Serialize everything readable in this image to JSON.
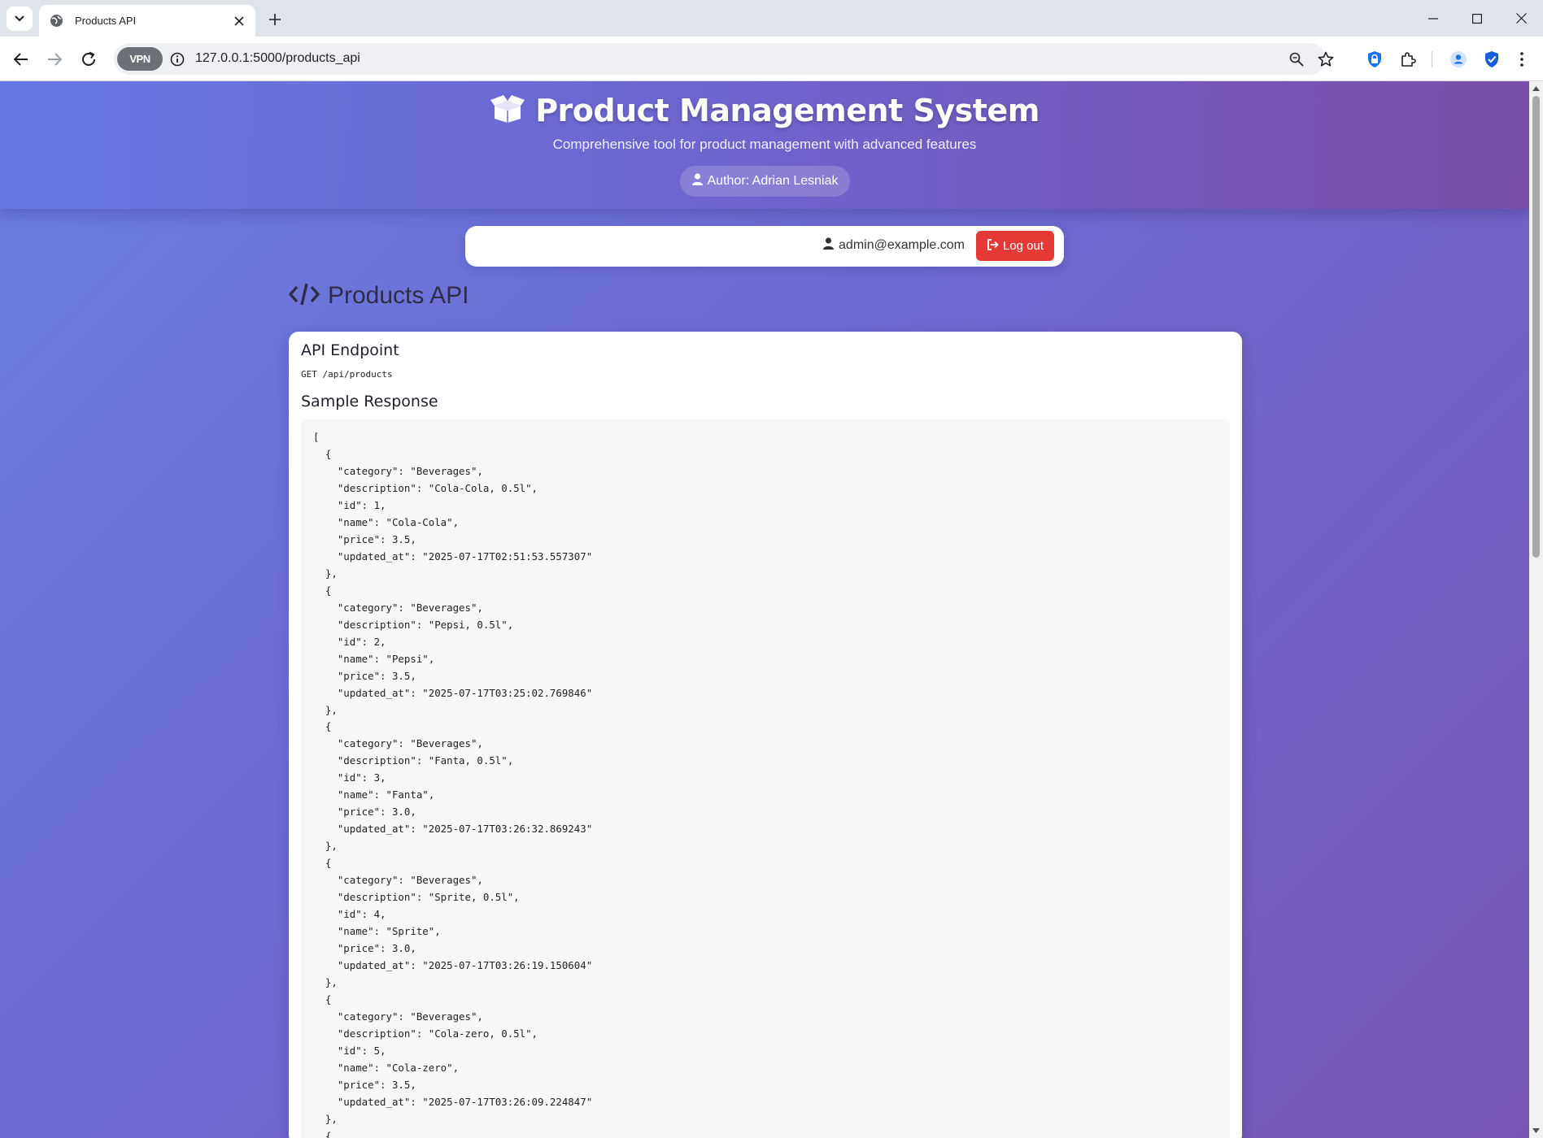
{
  "browser": {
    "tab_title": "Products API",
    "url": "127.0.0.1:5000/products_api",
    "vpn_label": "VPN",
    "icons": [
      "tab-list-icon",
      "globe-icon",
      "close-icon",
      "plus-icon",
      "minimize-icon",
      "maximize-icon",
      "close-window-icon",
      "back-icon",
      "forward-icon",
      "reload-icon",
      "info-icon",
      "zoom-icon",
      "star-icon",
      "shield-icon",
      "extensions-icon",
      "profile-icon",
      "bitwarden-icon",
      "menu-icon"
    ]
  },
  "header": {
    "title": "Product Management System",
    "subtitle": "Comprehensive tool for product management with advanced features",
    "author": "Author: Adrian Lesniak"
  },
  "userbar": {
    "email": "admin@example.com",
    "logout_label": "Log out"
  },
  "page": {
    "heading": "Products API"
  },
  "api": {
    "endpoint_heading": "API Endpoint",
    "endpoint": "GET /api/products",
    "sample_heading": "Sample Response",
    "sample_response": "[\n  {\n    \"category\": \"Beverages\",\n    \"description\": \"Cola-Cola, 0.5l\",\n    \"id\": 1,\n    \"name\": \"Cola-Cola\",\n    \"price\": 3.5,\n    \"updated_at\": \"2025-07-17T02:51:53.557307\"\n  },\n  {\n    \"category\": \"Beverages\",\n    \"description\": \"Pepsi, 0.5l\",\n    \"id\": 2,\n    \"name\": \"Pepsi\",\n    \"price\": 3.5,\n    \"updated_at\": \"2025-07-17T03:25:02.769846\"\n  },\n  {\n    \"category\": \"Beverages\",\n    \"description\": \"Fanta, 0.5l\",\n    \"id\": 3,\n    \"name\": \"Fanta\",\n    \"price\": 3.0,\n    \"updated_at\": \"2025-07-17T03:26:32.869243\"\n  },\n  {\n    \"category\": \"Beverages\",\n    \"description\": \"Sprite, 0.5l\",\n    \"id\": 4,\n    \"name\": \"Sprite\",\n    \"price\": 3.0,\n    \"updated_at\": \"2025-07-17T03:26:19.150604\"\n  },\n  {\n    \"category\": \"Beverages\",\n    \"description\": \"Cola-zero, 0.5l\",\n    \"id\": 5,\n    \"name\": \"Cola-zero\",\n    \"price\": 3.5,\n    \"updated_at\": \"2025-07-17T03:26:09.224847\"\n  },\n  {"
  },
  "colors": {
    "logout": "#e53935",
    "gradient_start": "#6a7fe3",
    "gradient_end": "#7757b5"
  }
}
